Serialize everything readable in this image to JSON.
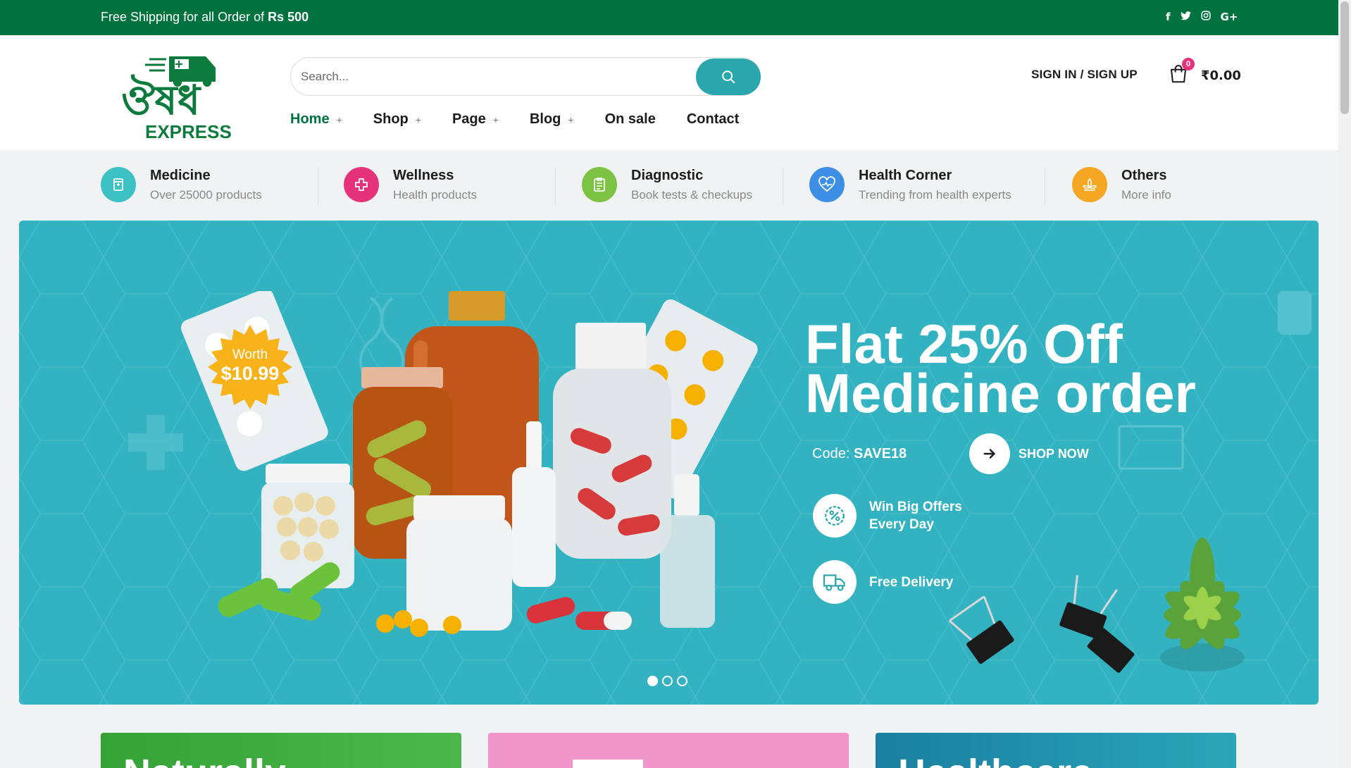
{
  "topbar": {
    "promo_prefix": "Free Shipping for all Order of",
    "promo_amount": "Rs 500",
    "social": [
      {
        "icon": "facebook-icon",
        "glyph": "f"
      },
      {
        "icon": "twitter-icon",
        "glyph": "🐦"
      },
      {
        "icon": "instagram-icon",
        "glyph": "◎"
      },
      {
        "icon": "google-plus-icon",
        "glyph": "G+"
      }
    ],
    "bg_color": "#00723f"
  },
  "header": {
    "logo_text_top": "ঔষধ",
    "logo_text_bottom": "EXPRESS",
    "search_placeholder": "Search...",
    "nav": [
      {
        "label": "Home",
        "has_sub": true,
        "active": true
      },
      {
        "label": "Shop",
        "has_sub": true
      },
      {
        "label": "Page",
        "has_sub": true
      },
      {
        "label": "Blog",
        "has_sub": true
      },
      {
        "label": "On sale",
        "has_sub": false
      },
      {
        "label": "Contact",
        "has_sub": false
      }
    ],
    "signin_label": "SIGN IN / SIGN UP",
    "cart_count": "0",
    "cart_total": "₹0.00",
    "accent_color": "#2aa6ad"
  },
  "categories": [
    {
      "title": "Medicine",
      "subtitle": "Over 25000 products",
      "icon": "pill-bottle-icon",
      "color": "#3cc1c4"
    },
    {
      "title": "Wellness",
      "subtitle": "Health products",
      "icon": "wellness-icon",
      "color": "#e5327a"
    },
    {
      "title": "Diagnostic",
      "subtitle": "Book tests & checkups",
      "icon": "clipboard-icon",
      "color": "#7cc243"
    },
    {
      "title": "Health Corner",
      "subtitle": "Trending from health experts",
      "icon": "heart-pulse-icon",
      "color": "#3d8fe6"
    },
    {
      "title": "Others",
      "subtitle": "More info",
      "icon": "lotus-icon",
      "color": "#f5a623"
    }
  ],
  "hero": {
    "badge_top": "Worth",
    "badge_price": "$10.99",
    "title_line1": "Flat 25% Off",
    "title_line2": "Medicine order",
    "code_label": "Code:",
    "code_value": "SAVE18",
    "shop_label": "SHOP NOW",
    "features": [
      {
        "text": "Win Big Offers Every Day",
        "icon": "discount-badge-icon"
      },
      {
        "text": "Free Delivery",
        "icon": "delivery-truck-icon"
      }
    ],
    "slides": 3,
    "active_slide": 1,
    "bg_color": "#33b3c2"
  },
  "cards": [
    {
      "title": "Naturally",
      "color": "#3aa63a"
    },
    {
      "title": "",
      "color": "#f096c8"
    },
    {
      "title": "Healthcare",
      "color": "#1b8fa5"
    }
  ]
}
